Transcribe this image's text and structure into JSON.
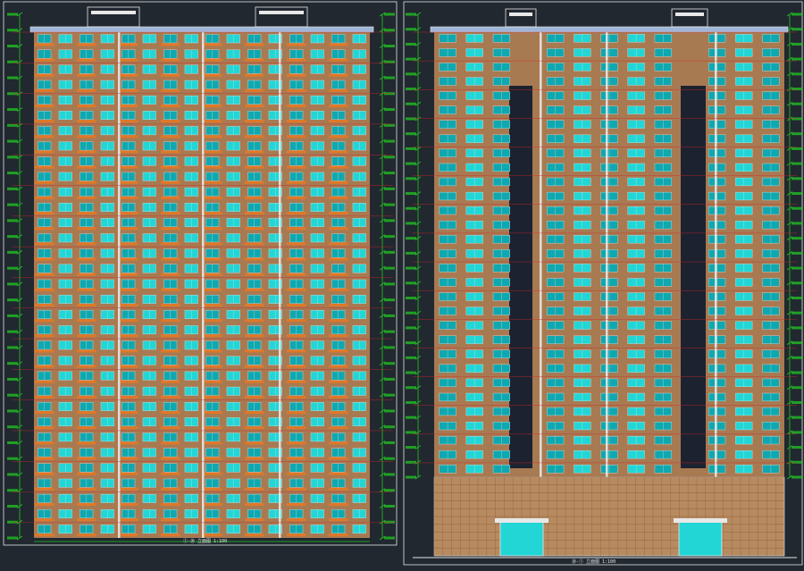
{
  "canvas": {
    "background": "#212830"
  },
  "colors": {
    "brick": "#a87a52",
    "brick_dark": "#8c6242",
    "glass": "#22d6d6",
    "glass_dark": "#0fa8b0",
    "frame": "#e8e8e8",
    "balcony": "#e07828",
    "dim_green": "#22c822",
    "level_red": "#d02828",
    "roof_blue": "#9fb6d8",
    "dark_panel": "#1c2230",
    "podium": "#b88a60"
  },
  "drawings": [
    {
      "name": "front-elevation-left",
      "floors": 33,
      "bays": 16,
      "title": "①-⑳ 立面图 1:100"
    },
    {
      "name": "side-elevation-right",
      "floors": 31,
      "bays": 13,
      "title": "⑳-① 立面图 1:100"
    }
  ]
}
